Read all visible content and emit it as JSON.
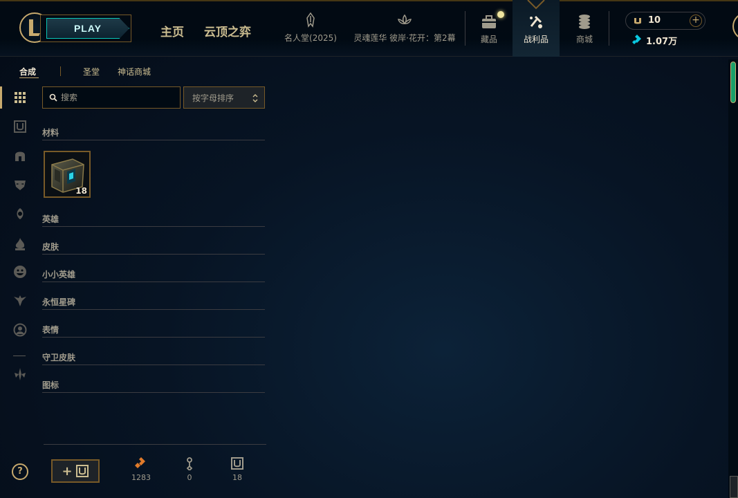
{
  "header": {
    "play_label": "PLAY",
    "nav_home": "主页",
    "nav_tft": "云顶之弈",
    "modes": [
      {
        "label": "名人堂(2025)",
        "icon": "hall-of-fame-icon"
      },
      {
        "label": "灵魂莲华 彼岸·花开：第2幕",
        "icon": "lotus-icon"
      }
    ],
    "icons": [
      {
        "label": "藏品",
        "icon": "collection-icon"
      },
      {
        "label": "战利品",
        "icon": "loot-icon"
      },
      {
        "label": "商城",
        "icon": "store-icon"
      }
    ],
    "currency_rp": "10",
    "currency_be": "1.07万"
  },
  "subtabs": [
    "合成",
    "圣堂",
    "神话商城"
  ],
  "search": {
    "placeholder": "搜索"
  },
  "sort": {
    "label": "按字母排序"
  },
  "categories": {
    "materials": "材料",
    "champions": "英雄",
    "skins": "皮肤",
    "little_legends": "小小英雄",
    "eternals": "永恒星碑",
    "emotes": "表情",
    "ward_skins": "守卫皮肤",
    "icons": "图标"
  },
  "material_item": {
    "name": "hextech-chest-item",
    "count": "18"
  },
  "footer": {
    "orange_essence": "1283",
    "keys": "0",
    "chests": "18"
  },
  "help_label": "?",
  "colors": {
    "gold": "#c8aa6e",
    "gold_dark": "#785a28",
    "text": "#cdbe91",
    "teal": "#0ac8b9",
    "background": "#010a13"
  }
}
